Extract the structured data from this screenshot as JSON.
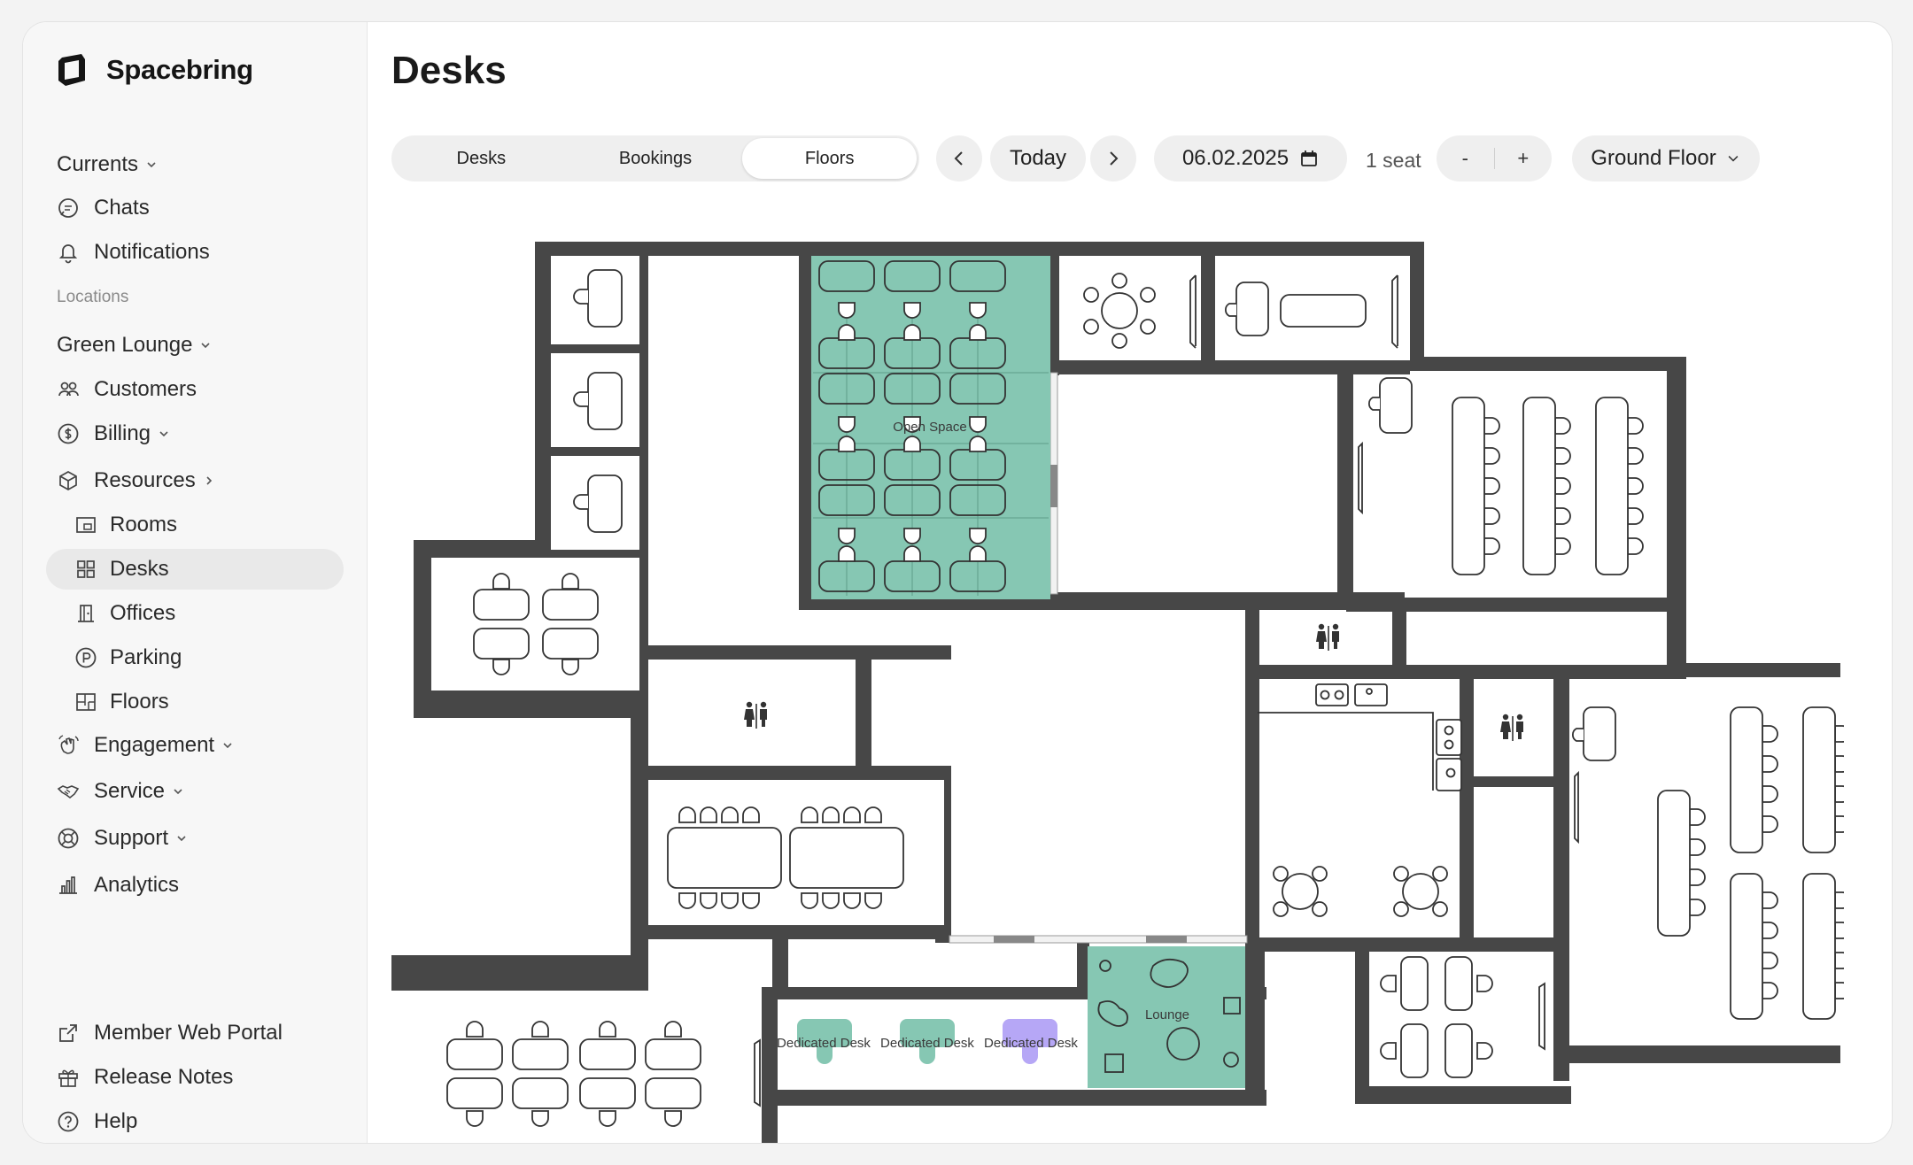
{
  "brand": {
    "name": "Spacebring"
  },
  "sidebar": {
    "currents": "Currents",
    "chats": "Chats",
    "notifications": "Notifications",
    "locations_heading": "Locations",
    "location": "Green Lounge",
    "customers": "Customers",
    "billing": "Billing",
    "resources": "Resources",
    "rooms": "Rooms",
    "desks": "Desks",
    "offices": "Offices",
    "parking": "Parking",
    "floors": "Floors",
    "engagement": "Engagement",
    "service": "Service",
    "support": "Support",
    "analytics": "Analytics",
    "member_portal": "Member Web Portal",
    "release_notes": "Release Notes",
    "help": "Help"
  },
  "main": {
    "title": "Desks",
    "tabs": [
      {
        "label": "Desks"
      },
      {
        "label": "Bookings"
      },
      {
        "label": "Floors"
      }
    ],
    "active_tab": "Floors",
    "today_label": "Today",
    "date": "06.02.2025",
    "seats": "1 seat",
    "minus": "-",
    "plus": "+",
    "floor": "Ground Floor"
  },
  "floorplan": {
    "labels": {
      "open_space": "Open Space",
      "lounge": "Lounge",
      "dedicated_1": "Dedicated Desk",
      "dedicated_2": "Dedicated Desk",
      "dedicated_3": "Dedicated Desk"
    },
    "colors": {
      "available": "#86c7b3",
      "selected": "#b6a7f6",
      "walls": "#474747"
    }
  }
}
